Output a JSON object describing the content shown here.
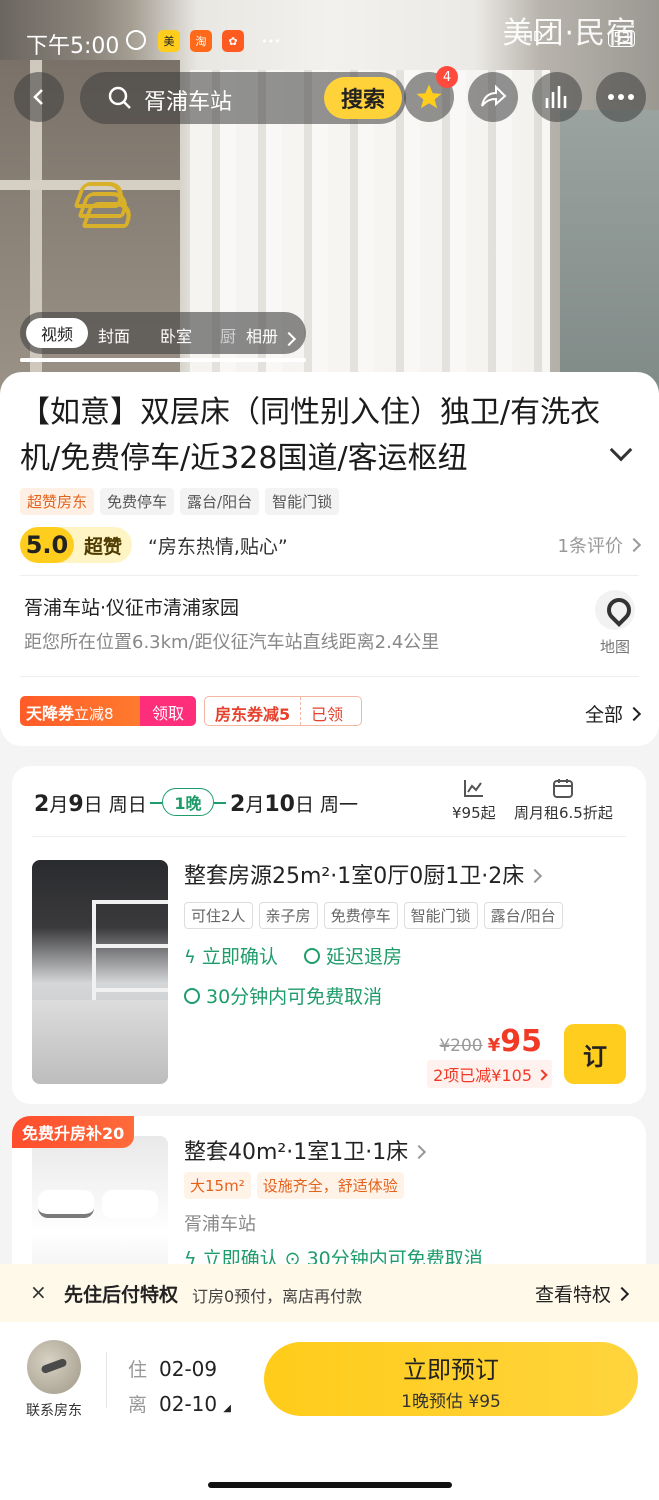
{
  "status_bar": {
    "time": "下午5:00",
    "watermark": "美团·民宿",
    "signal": "HD",
    "battery": "53"
  },
  "nav": {
    "search_query": "胥浦车站",
    "search_button": "搜索",
    "favorites_badge": "4"
  },
  "media_tabs": {
    "items": [
      "视频",
      "封面",
      "卧室",
      "厨"
    ],
    "album": "相册"
  },
  "listing": {
    "title": "【如意】双层床（同性别入住）独卫/有洗衣机/免费停车/近328国道/客运枢纽",
    "tags": [
      "超赞房东",
      "免费停车",
      "露台/阳台",
      "智能门锁"
    ],
    "score": "5.0",
    "score_level": "超赞",
    "quote": "“房东热情,贴心”",
    "reviews": "1条评价",
    "address": "胥浦车站·仪征市清浦家园",
    "distance": "距您所在位置6.3km/距仪征汽车站直线距离2.4公里",
    "map_label": "地图"
  },
  "coupons": {
    "c1_name": "天降券",
    "c1_desc": "立减8",
    "c1_action": "领取",
    "c2_name": "房东券减5",
    "c2_action": "已领",
    "all": "全部"
  },
  "booking": {
    "checkin_month": "2",
    "checkin_day": "9",
    "checkin_weekday": "周日",
    "nights": "1晚",
    "checkout_month": "2",
    "checkout_day": "10",
    "checkout_weekday": "周一",
    "price_calendar": "¥95起",
    "monthly": "周月租6.5折起"
  },
  "room1": {
    "title": "整套房源25m²·1室0厅0厨1卫·2床",
    "tags": [
      "可住2人",
      "亲子房",
      "免费停车",
      "智能门锁",
      "露台/阳台"
    ],
    "feature1": "立即确认",
    "feature2": "延迟退房",
    "feature3": "30分钟内可免费取消",
    "old_price": "¥200",
    "currency": "¥",
    "price": "95",
    "discount": "2项已减¥105",
    "order": "订"
  },
  "room2": {
    "badge": "免费升房补20",
    "title": "整套40m²·1室1卫·1床",
    "tags": [
      "大15m²",
      "设施齐全，舒适体验"
    ],
    "location": "胥浦车站",
    "features": "立即确认 ⊙ 30分钟内可免费取消"
  },
  "notice": {
    "close": "×",
    "title": "先住后付特权",
    "desc": "订房0预付，离店再付款",
    "link": "查看特权"
  },
  "bottom": {
    "host_label": "联系房东",
    "checkin_label": "住",
    "checkin_date": "02-09",
    "checkout_label": "离",
    "checkout_date": "02-10",
    "book_label": "立即预订",
    "book_sub": "1晚预估 ¥95"
  }
}
